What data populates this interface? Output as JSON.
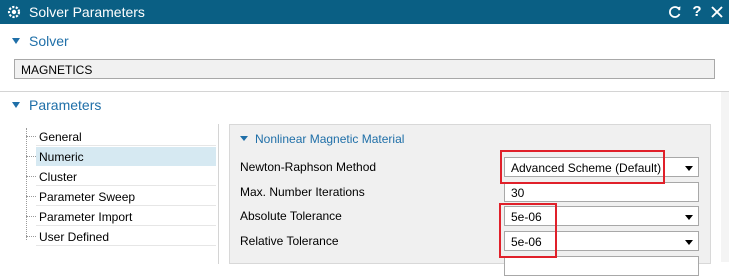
{
  "window": {
    "title": "Solver Parameters",
    "bg_color": "#0a5f84",
    "accent": "#1f6fa8",
    "highlight": "#e0202a"
  },
  "title_buttons": [
    "refresh-icon",
    "help-icon",
    "close-icon"
  ],
  "help_glyph": "?",
  "solver_section": {
    "label": "Solver",
    "value": "MAGNETICS"
  },
  "parameters_section": {
    "label": "Parameters"
  },
  "tree": {
    "items": [
      {
        "label": "General",
        "selected": false
      },
      {
        "label": "Numeric",
        "selected": true
      },
      {
        "label": "Cluster",
        "selected": false
      },
      {
        "label": "Parameter Sweep",
        "selected": false
      },
      {
        "label": "Parameter Import",
        "selected": false
      },
      {
        "label": "User Defined",
        "selected": false
      }
    ]
  },
  "nonlinear": {
    "label": "Nonlinear Magnetic Material",
    "rows": [
      {
        "label": "Newton-Raphson Method",
        "value": "Advanced Scheme (Default)",
        "dropdown": true
      },
      {
        "label": "Max. Number Iterations",
        "value": "30",
        "dropdown": false
      },
      {
        "label": "Absolute Tolerance",
        "value": "5e-06",
        "dropdown": true
      },
      {
        "label": "Relative Tolerance",
        "value": "5e-06",
        "dropdown": true
      }
    ]
  }
}
